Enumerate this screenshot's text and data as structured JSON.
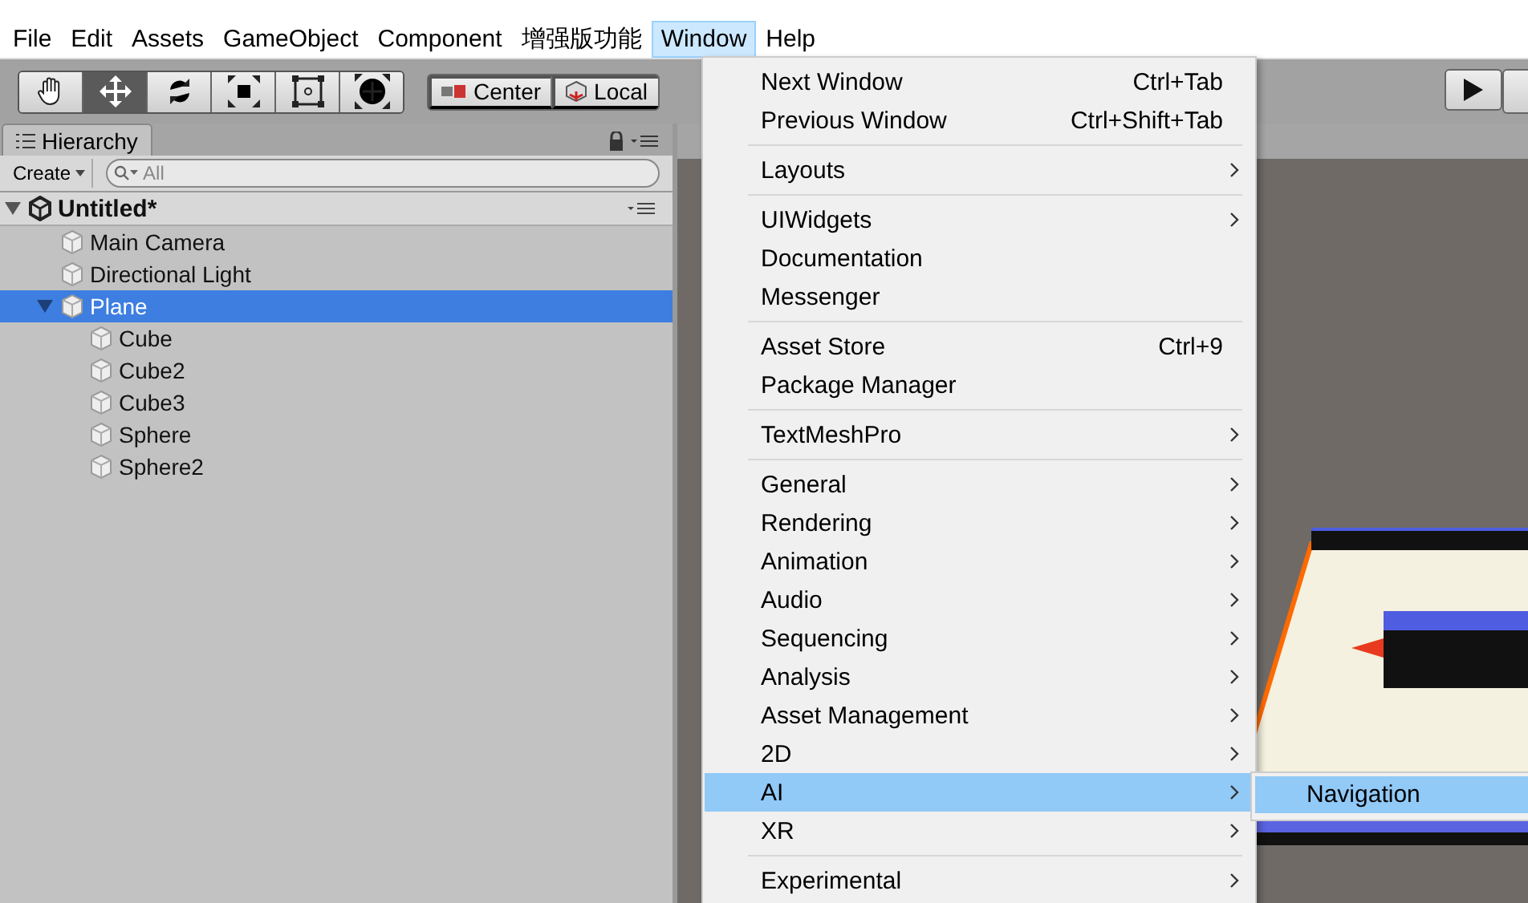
{
  "menu_bar": {
    "items": [
      {
        "label": "File",
        "selected": false
      },
      {
        "label": "Edit",
        "selected": false
      },
      {
        "label": "Assets",
        "selected": false
      },
      {
        "label": "GameObject",
        "selected": false
      },
      {
        "label": "Component",
        "selected": false
      },
      {
        "label": "增强版功能",
        "selected": false
      },
      {
        "label": "Window",
        "selected": true
      },
      {
        "label": "Help",
        "selected": false
      }
    ]
  },
  "toolbar": {
    "tools": [
      {
        "kind": "hand",
        "selected": false
      },
      {
        "kind": "move",
        "selected": true
      },
      {
        "kind": "rotate",
        "selected": false
      },
      {
        "kind": "scale",
        "selected": false
      },
      {
        "kind": "rect",
        "selected": false
      },
      {
        "kind": "transform",
        "selected": false
      }
    ],
    "pivot_buttons": [
      {
        "kind": "center",
        "label": "Center"
      },
      {
        "kind": "local",
        "label": "Local"
      }
    ]
  },
  "hierarchy": {
    "tab": "Hierarchy",
    "create_button": "Create",
    "search": {
      "placeholder": "All"
    },
    "tree": [
      {
        "label": "Untitled*",
        "kind": "scene",
        "expanded": true,
        "selected": false,
        "children": [
          {
            "label": "Main Camera",
            "kind": "object",
            "selected": false
          },
          {
            "label": "Directional Light",
            "kind": "object",
            "selected": false
          },
          {
            "label": "Plane",
            "kind": "object",
            "expanded": true,
            "selected": true,
            "children": [
              {
                "label": "Cube",
                "kind": "object",
                "selected": false
              },
              {
                "label": "Cube2",
                "kind": "object",
                "selected": false
              },
              {
                "label": "Cube3",
                "kind": "object",
                "selected": false
              },
              {
                "label": "Sphere",
                "kind": "object",
                "selected": false
              },
              {
                "label": "Sphere2",
                "kind": "object",
                "selected": false
              }
            ]
          }
        ]
      }
    ]
  },
  "window_menu": {
    "groups": [
      [
        {
          "label": "Next Window",
          "shortcut": "Ctrl+Tab",
          "submenu": false,
          "selected": false
        },
        {
          "label": "Previous Window",
          "shortcut": "Ctrl+Shift+Tab",
          "submenu": false,
          "selected": false
        }
      ],
      [
        {
          "label": "Layouts",
          "submenu": true,
          "selected": false
        }
      ],
      [
        {
          "label": "UIWidgets",
          "submenu": true,
          "selected": false
        },
        {
          "label": "Documentation",
          "submenu": false,
          "selected": false
        },
        {
          "label": "Messenger",
          "submenu": false,
          "selected": false
        }
      ],
      [
        {
          "label": "Asset Store",
          "shortcut": "Ctrl+9",
          "submenu": false,
          "selected": false
        },
        {
          "label": "Package Manager",
          "submenu": false,
          "selected": false
        }
      ],
      [
        {
          "label": "TextMeshPro",
          "submenu": true,
          "selected": false
        }
      ],
      [
        {
          "label": "General",
          "submenu": true,
          "selected": false
        },
        {
          "label": "Rendering",
          "submenu": true,
          "selected": false
        },
        {
          "label": "Animation",
          "submenu": true,
          "selected": false
        },
        {
          "label": "Audio",
          "submenu": true,
          "selected": false
        },
        {
          "label": "Sequencing",
          "submenu": true,
          "selected": false
        },
        {
          "label": "Analysis",
          "submenu": true,
          "selected": false
        },
        {
          "label": "Asset Management",
          "submenu": true,
          "selected": false
        },
        {
          "label": "2D",
          "submenu": true,
          "selected": false
        },
        {
          "label": "AI",
          "submenu": true,
          "selected": true
        },
        {
          "label": "XR",
          "submenu": true,
          "selected": false
        }
      ],
      [
        {
          "label": "Experimental",
          "submenu": true,
          "selected": false
        }
      ]
    ]
  },
  "ai_submenu": {
    "items": [
      {
        "label": "Navigation",
        "selected": true
      }
    ]
  }
}
